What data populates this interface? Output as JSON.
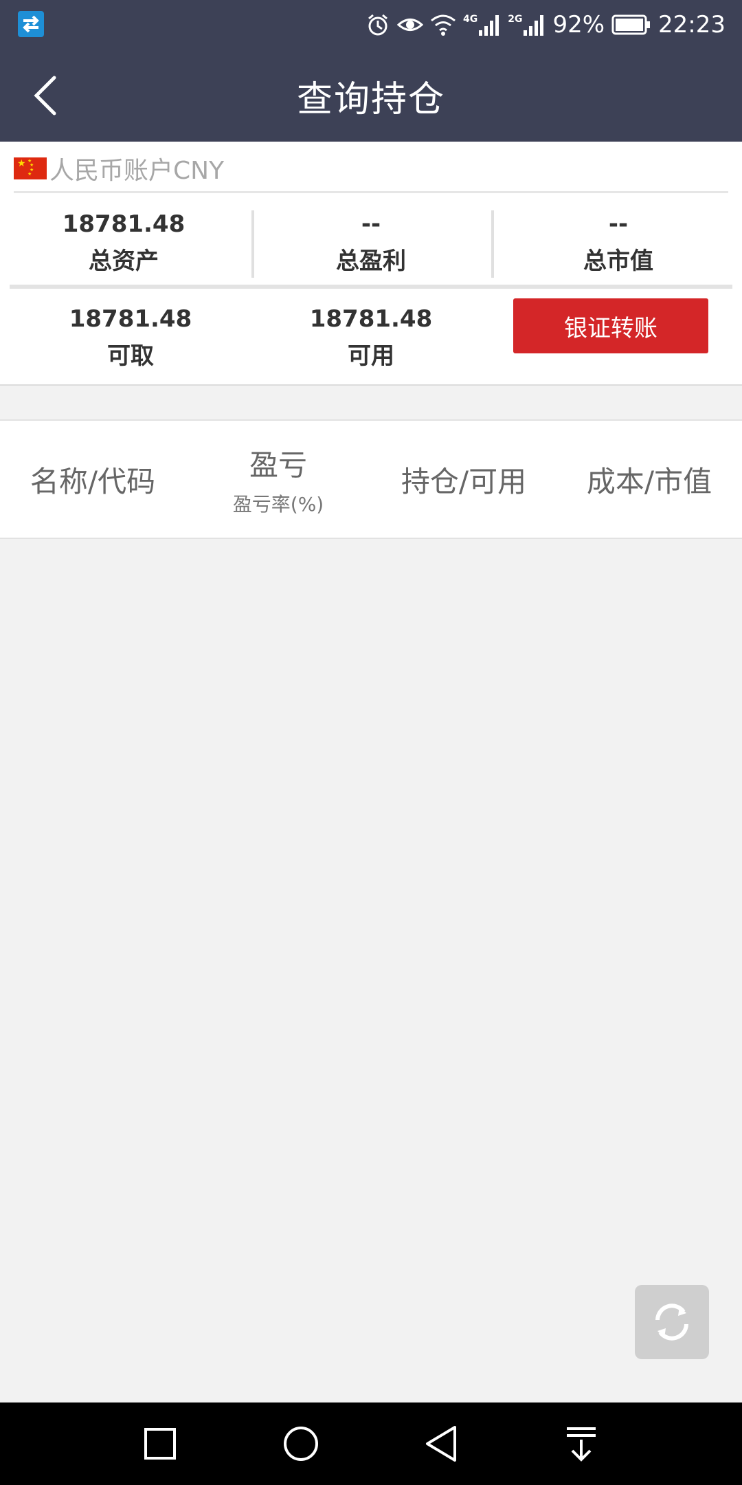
{
  "status_bar": {
    "network_4g": "4G",
    "network_2g": "2G",
    "battery": "92%",
    "time": "22:23"
  },
  "header": {
    "title": "查询持仓"
  },
  "account": {
    "label": "人民币账户CNY",
    "total_assets_value": "18781.48",
    "total_assets_label": "总资产",
    "total_profit_value": "--",
    "total_profit_label": "总盈利",
    "total_market_value": "--",
    "total_market_label": "总市值",
    "withdrawable_value": "18781.48",
    "withdrawable_label": "可取",
    "available_value": "18781.48",
    "available_label": "可用",
    "transfer_button": "银证转账"
  },
  "table_header": {
    "col1": "名称/代码",
    "col2_main": "盈亏",
    "col2_sub": "盈亏率(%)",
    "col3": "持仓/可用",
    "col4": "成本/市值"
  },
  "colors": {
    "header_bg": "#3d4156",
    "accent_red": "#d42628"
  }
}
